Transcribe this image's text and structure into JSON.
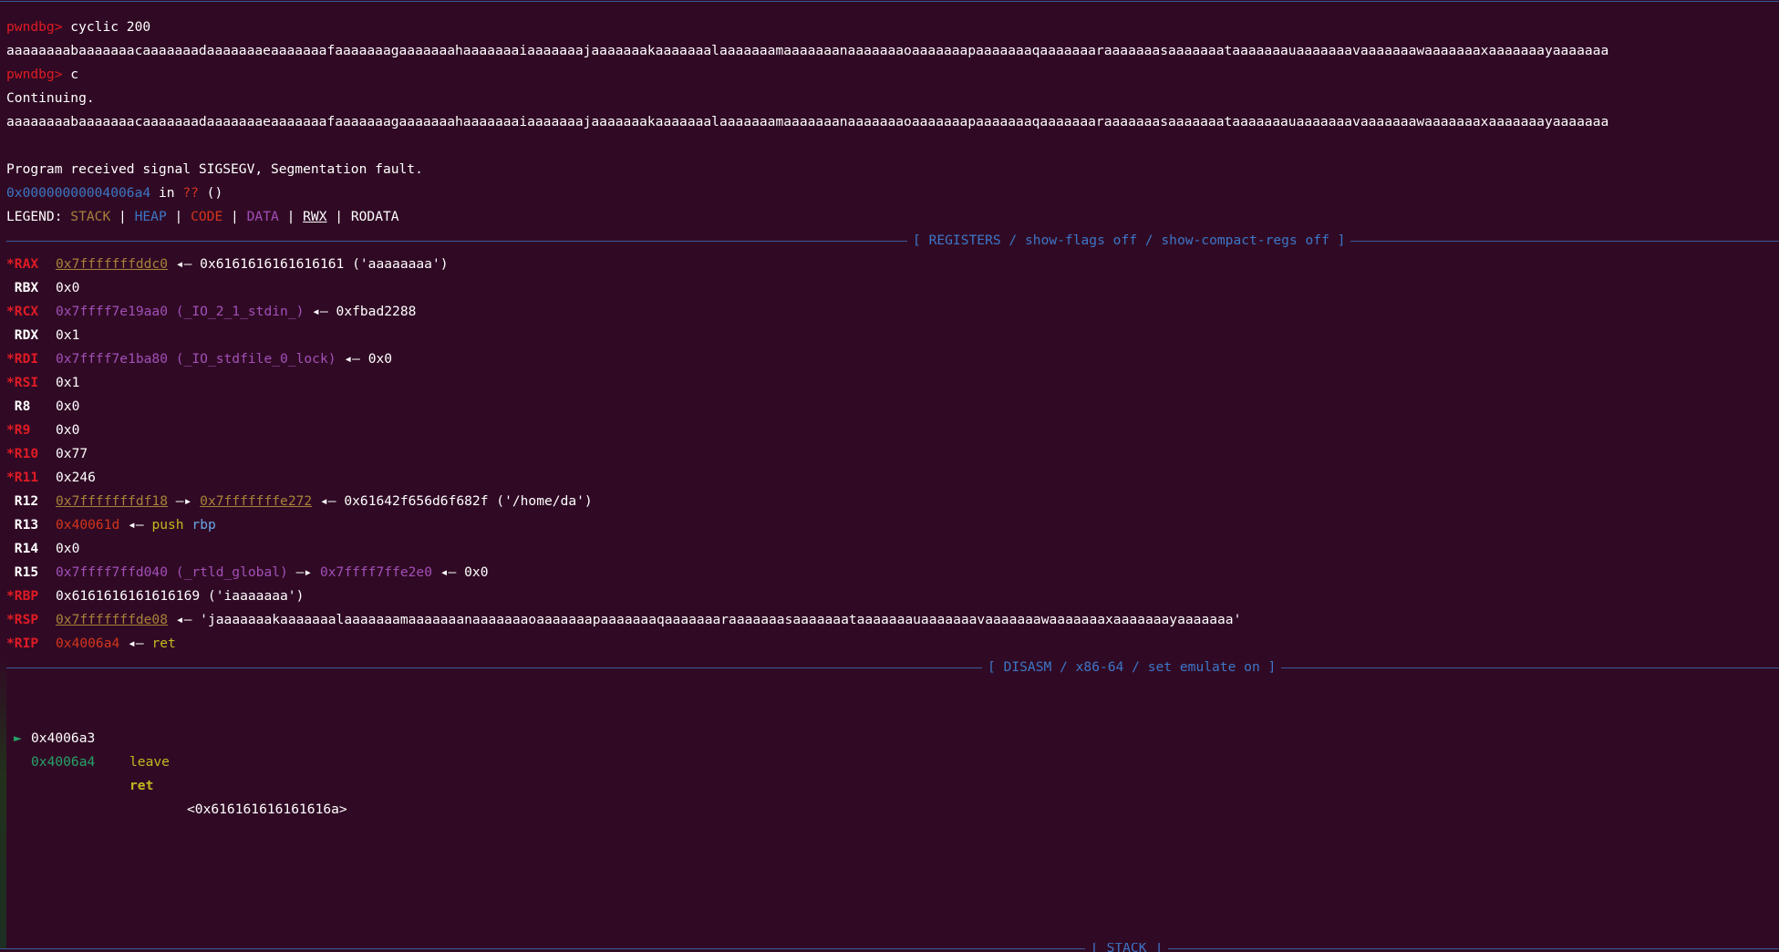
{
  "session": [
    {
      "prompt": "pwndbg> ",
      "command": "cyclic 200"
    },
    {
      "output": "aaaaaaaabaaaaaaacaaaaaaadaaaaaaaeaaaaaaafaaaaaaagaaaaaaahaaaaaaaiaaaaaaajaaaaaaakaaaaaaalaaaaaaamaaaaaaanaaaaaaaoaaaaaaapaaaaaaaqaaaaaaaraaaaaaasaaaaaaataaaaaaauaaaaaaavaaaaaaawaaaaaaaxaaaaaaayaaaaaaa"
    },
    {
      "prompt": "pwndbg> ",
      "command": "c"
    },
    {
      "output": "Continuing."
    },
    {
      "output": "aaaaaaaabaaaaaaacaaaaaaadaaaaaaaeaaaaaaafaaaaaaagaaaaaaahaaaaaaaiaaaaaaajaaaaaaakaaaaaaalaaaaaaamaaaaaaanaaaaaaaoaaaaaaapaaaaaaaqaaaaaaaraaaaaaasaaaaaaataaaaaaauaaaaaaavaaaaaaawaaaaaaaxaaaaaaayaaaaaaa"
    },
    {
      "output": ""
    },
    {
      "output": "Program received signal SIGSEGV, Segmentation fault."
    }
  ],
  "fault": {
    "addr": "0x00000000004006a4",
    "in": " in ",
    "func": "??",
    "args": " ()"
  },
  "legend": {
    "label": "LEGEND: ",
    "stack": "STACK",
    "heap": "HEAP",
    "code": "CODE",
    "data": "DATA",
    "rwx": "RWX",
    "rodata": "RODATA",
    "sep": " | "
  },
  "registers_title": "[ REGISTERS / show-flags off / show-compact-regs off ]",
  "registers": {
    "rax": {
      "name": "*RAX",
      "ptr": "0x7fffffffddc0",
      "arrow": " ◂— ",
      "val": "0x6161616161616161 ('aaaaaaaa')"
    },
    "rbx": {
      "name": " RBX",
      "val": "0x0"
    },
    "rcx": {
      "name": "*RCX",
      "ptr": "0x7ffff7e19aa0 (_IO_2_1_stdin_)",
      "arrow": " ◂— ",
      "val": "0xfbad2288"
    },
    "rdx": {
      "name": " RDX",
      "val": "0x1"
    },
    "rdi": {
      "name": "*RDI",
      "ptr": "0x7ffff7e1ba80 (_IO_stdfile_0_lock)",
      "arrow": " ◂— ",
      "val": "0x0"
    },
    "rsi": {
      "name": "*RSI",
      "val": "0x1"
    },
    "r8": {
      "name": " R8",
      "val": "0x0"
    },
    "r9": {
      "name": "*R9",
      "val": "0x0"
    },
    "r10": {
      "name": "*R10",
      "val": "0x77"
    },
    "r11": {
      "name": "*R11",
      "val": "0x246"
    },
    "r12": {
      "name": " R12",
      "ptr1": "0x7fffffffdf18",
      "arrow1": " —▸ ",
      "ptr2": "0x7fffffffe272",
      "arrow2": " ◂— ",
      "val": "0x61642f656d6f682f ('/home/da')"
    },
    "r13": {
      "name": " R13",
      "ptr": "0x40061d",
      "arrow": " ◂— ",
      "ins": "push",
      "reg": "rbp"
    },
    "r14": {
      "name": " R14",
      "val": "0x0"
    },
    "r15": {
      "name": " R15",
      "ptr1": "0x7ffff7ffd040 (_rtld_global)",
      "arrow1": " —▸ ",
      "ptr2": "0x7ffff7ffe2e0",
      "arrow2": " ◂— ",
      "val": "0x0"
    },
    "rbp": {
      "name": "*RBP",
      "val": "0x6161616161616169 ('iaaaaaaa')"
    },
    "rsp": {
      "name": "*RSP",
      "ptr": "0x7fffffffde08",
      "arrow": " ◂— ",
      "val": "'jaaaaaaakaaaaaaalaaaaaaamaaaaaaanaaaaaaaoaaaaaaapaaaaaaaqaaaaaaaraaaaaaasaaaaaaataaaaaaauaaaaaaavaaaaaaawaaaaaaaxaaaaaaayaaaaaaa'"
    },
    "rip": {
      "name": "*RIP",
      "ptr": "0x4006a4",
      "arrow": " ◂— ",
      "ins": "ret"
    }
  },
  "disasm_title": "[ DISASM / x86-64 / set emulate on ]",
  "disasm": [
    {
      "cursor": "",
      "addr": "0x4006a3",
      "mnem": "leave",
      "ops": ""
    },
    {
      "cursor": "►",
      "addr": "0x4006a4",
      "mnem": "ret",
      "ops": "<0x616161616161616a>"
    }
  ],
  "stack_title": "[ STACK ]"
}
